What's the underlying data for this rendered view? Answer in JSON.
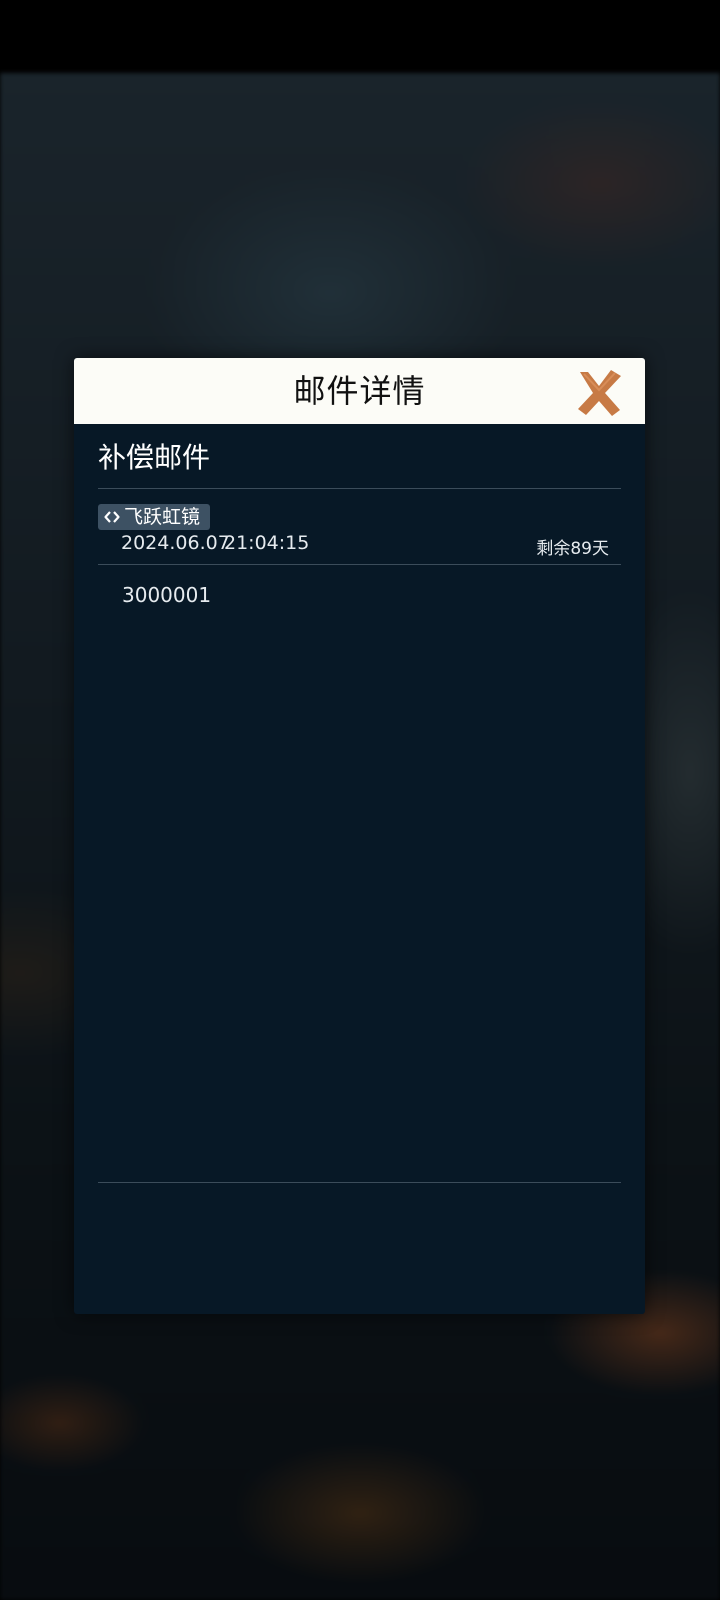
{
  "dialog": {
    "title": "邮件详情",
    "close_icon": "close-icon",
    "accent_color": "#c77a45"
  },
  "mail": {
    "subject": "补偿邮件",
    "sender": "飞跃虹镜",
    "sender_icon": "code-brackets-icon",
    "date": "2024.06.07",
    "time": "21:04:15",
    "remaining": "剩余89天",
    "body": "3000001"
  }
}
